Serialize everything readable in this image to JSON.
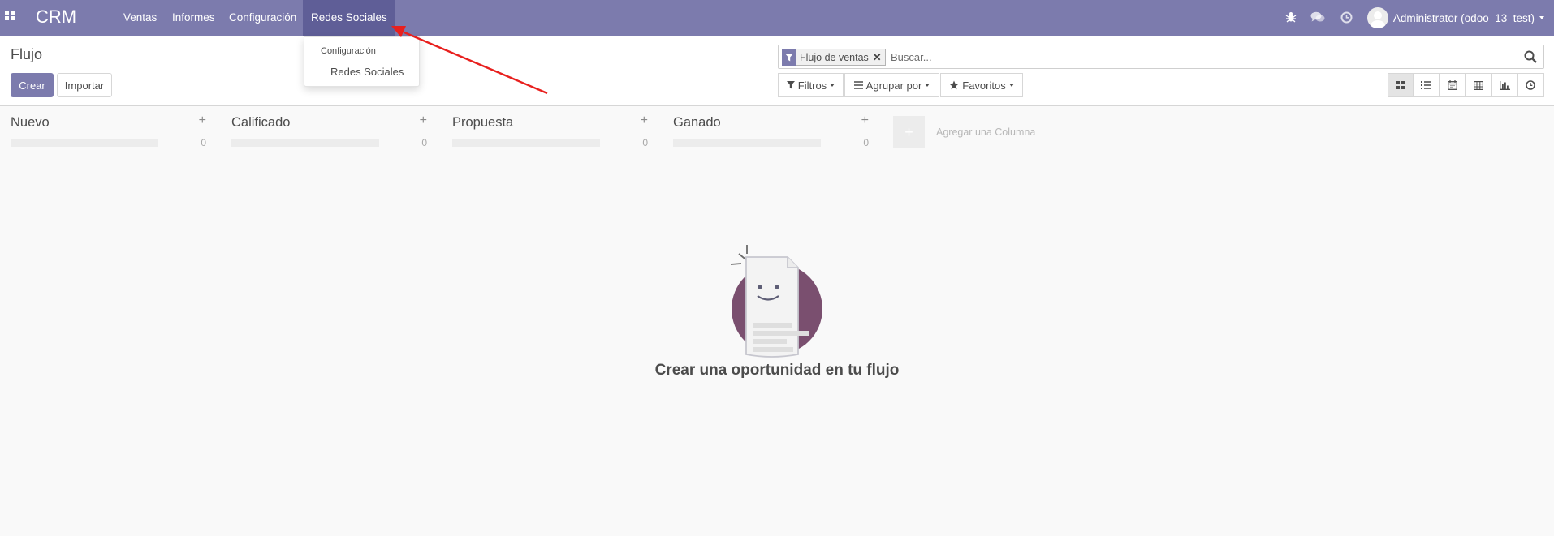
{
  "navbar": {
    "brand": "CRM",
    "menu": [
      {
        "label": "Ventas"
      },
      {
        "label": "Informes"
      },
      {
        "label": "Configuración"
      },
      {
        "label": "Redes Sociales",
        "active": true
      }
    ],
    "icons": [
      "bug-icon",
      "chat-icon",
      "activity-clock-icon"
    ],
    "user": "Administrator (odoo_13_test)"
  },
  "dropdown": {
    "header": "Configuración",
    "items": [
      {
        "label": "Redes Sociales"
      }
    ]
  },
  "control_panel": {
    "breadcrumb": "Flujo",
    "create_label": "Crear",
    "import_label": "Importar",
    "search": {
      "facet": "Flujo de ventas",
      "placeholder": "Buscar..."
    },
    "filters_label": "Filtros",
    "group_by_label": "Agrupar por",
    "favorites_label": "Favoritos",
    "views": [
      "kanban-view-icon",
      "list-view-icon",
      "calendar-view-icon",
      "pivot-view-icon",
      "graph-view-icon",
      "activity-view-icon"
    ],
    "active_view": "kanban-view-icon"
  },
  "kanban": {
    "columns": [
      {
        "title": "Nuevo",
        "count": "0"
      },
      {
        "title": "Calificado",
        "count": "0"
      },
      {
        "title": "Propuesta",
        "count": "0"
      },
      {
        "title": "Ganado",
        "count": "0"
      }
    ],
    "add_column_label": "Agregar una Columna"
  },
  "empty_state": {
    "title": "Crear una oportunidad en tu flujo"
  },
  "colors": {
    "navbar": "#7c7bad",
    "navbar_active": "#5f5e97",
    "primary": "#7c7bad",
    "illustration_circle": "#7a4f6f",
    "annotation_arrow": "#e8201e"
  }
}
